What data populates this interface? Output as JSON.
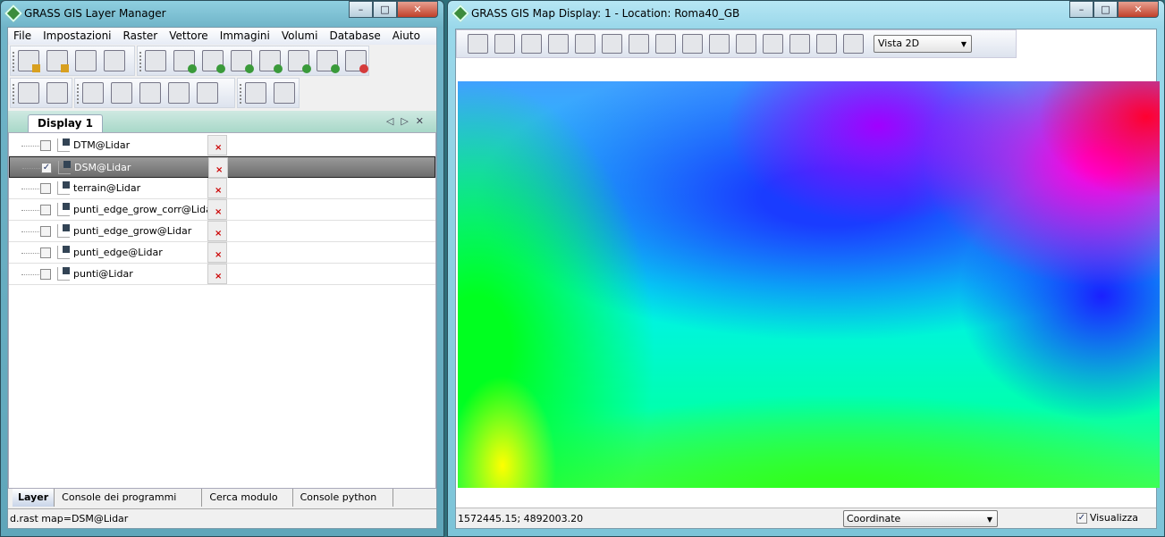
{
  "layer_manager": {
    "title": "GRASS GIS Layer Manager",
    "menu": [
      "File",
      "Impostazioni",
      "Raster",
      "Vettore",
      "Immagini",
      "Volumi",
      "Database",
      "Aiuto"
    ],
    "toolbar1a": [
      "new-display-icon",
      "new-workspace-icon",
      "open-workspace-icon",
      "save-workspace-icon"
    ],
    "toolbar1b": [
      "import-layer-icon",
      "add-raster-icon",
      "add-raster-misc-icon",
      "add-vector-icon",
      "add-vector-misc-icon",
      "add-command-layer-icon",
      "add-group-icon",
      "remove-layer-icon"
    ],
    "toolbar2a": [
      "edit-vector-icon",
      "attribute-table-icon"
    ],
    "toolbar2b": [
      "mapcalc-icon",
      "graphical-modeler-icon",
      "georectifier-icon",
      "map-swipe-icon",
      "cartographic-composer-icon"
    ],
    "toolbar2c": [
      "settings-icon",
      "help-icon"
    ],
    "display_tab": "Display 1",
    "layers": [
      {
        "name": "DTM@Lidar",
        "type": "raster",
        "checked": false,
        "selected": false
      },
      {
        "name": "DSM@Lidar",
        "type": "raster",
        "checked": true,
        "selected": true
      },
      {
        "name": "terrain@Lidar",
        "type": "vector",
        "checked": false,
        "selected": false
      },
      {
        "name": "punti_edge_grow_corr@Lidar",
        "type": "vector",
        "checked": false,
        "selected": false
      },
      {
        "name": "punti_edge_grow@Lidar",
        "type": "vector",
        "checked": false,
        "selected": false
      },
      {
        "name": "punti_edge@Lidar",
        "type": "vector",
        "checked": false,
        "selected": false
      },
      {
        "name": "punti@Lidar",
        "type": "vector",
        "checked": false,
        "selected": false
      }
    ],
    "bottom_tabs": [
      "Layer",
      "Console dei programmi",
      "Cerca modulo",
      "Console python"
    ],
    "status": "d.rast map=DSM@Lidar"
  },
  "map_display": {
    "title": "GRASS GIS Map Display: 1  - Location: Roma40_GB",
    "toolbar": [
      "display-map-icon",
      "render-map-icon",
      "erase-icon",
      "pointer-icon",
      "query-icon",
      "pan-icon",
      "zoom-in-icon",
      "zoom-out-icon",
      "zoom-extent-icon",
      "zoom-back-icon",
      "zoom-menu-icon",
      "analyze-icon",
      "overlay-icon",
      "save-image-icon",
      "print-icon"
    ],
    "view_mode": "Vista 2D",
    "coordinates": "1572445.15; 4892003.20",
    "status_mode": "Coordinate",
    "render_label": "Visualizza",
    "render_checked": true
  }
}
